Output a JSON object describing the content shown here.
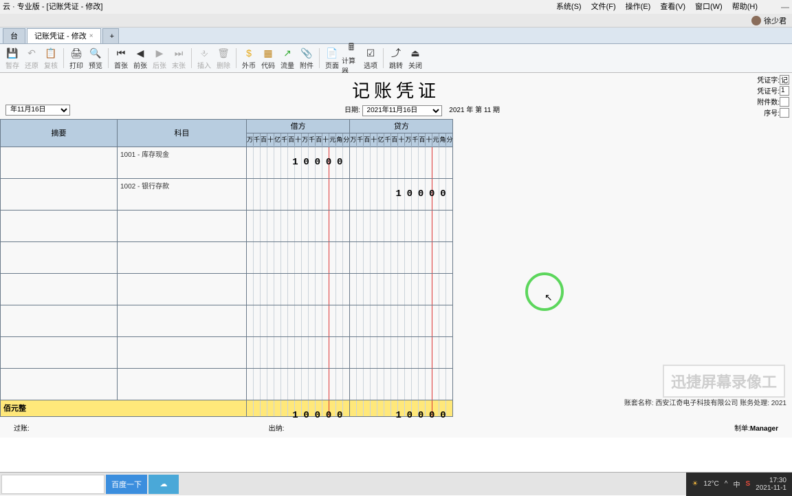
{
  "window": {
    "title": "云 · 专业版 - [记账凭证 - 修改]",
    "user": "徐少君"
  },
  "menubar": {
    "system": "系统(S)",
    "file": "文件(F)",
    "operate": "操作(E)",
    "view": "查看(V)",
    "window": "窗口(W)",
    "help": "帮助(H)"
  },
  "tabs": {
    "home": "台",
    "current": "记账凭证 - 修改"
  },
  "toolbar": {
    "save": "暂存",
    "restore": "还原",
    "copy": "复核",
    "print": "打印",
    "preview": "预览",
    "first": "首张",
    "prev": "前张",
    "next": "后张",
    "last": "末张",
    "insert": "插入",
    "delete": "删除",
    "forex": "外币",
    "code": "代码",
    "flow": "流量",
    "attach": "附件",
    "page": "页面",
    "calc": "计算器",
    "option": "选项",
    "jump": "跳转",
    "close": "关闭"
  },
  "voucher": {
    "title": "记账凭证",
    "meta": {
      "word_label": "凭证字:",
      "word_val": "记",
      "num_label": "凭证号:",
      "num_val": "1",
      "attach_label": "附件数:",
      "seq_label": "序号:"
    },
    "date_left": "年11月16日",
    "date_label": "日期:",
    "date_val": "2021年11月16日",
    "period": "2021 年 第 11 期",
    "headers": {
      "summary": "摘要",
      "subject": "科目",
      "debit": "借方",
      "credit": "贷方"
    },
    "digit_labels": [
      "万",
      "千",
      "百",
      "十",
      "亿",
      "千",
      "百",
      "十",
      "万",
      "千",
      "百",
      "十",
      "元",
      "角",
      "分"
    ],
    "digit_short": [
      "万",
      "千",
      "百",
      "十",
      "亿",
      "千",
      "百",
      "十",
      "万",
      "千",
      "百",
      "十",
      "元",
      "角",
      "分"
    ],
    "rows": [
      {
        "subject": "1001 - 库存现金",
        "debit": "10000",
        "credit": ""
      },
      {
        "subject": "1002 - 银行存款",
        "debit": "",
        "credit": "10000"
      }
    ],
    "total_label": "佰元整",
    "total_debit": "10000",
    "total_credit": "10000",
    "sign": {
      "post": "过账:",
      "cashier": "出纳:",
      "maker_label": "制单:",
      "maker": "Manager"
    }
  },
  "footer": {
    "account": "账套名称:  西安江奇电子科技有限公司  账务处理:  2021"
  },
  "watermark": "迅捷屏幕录像工",
  "taskbar": {
    "search_btn": "百度一下",
    "weather": "12°C",
    "ime1": "中",
    "ime2": "S",
    "time": "17:30",
    "date": "2021-11-1"
  }
}
